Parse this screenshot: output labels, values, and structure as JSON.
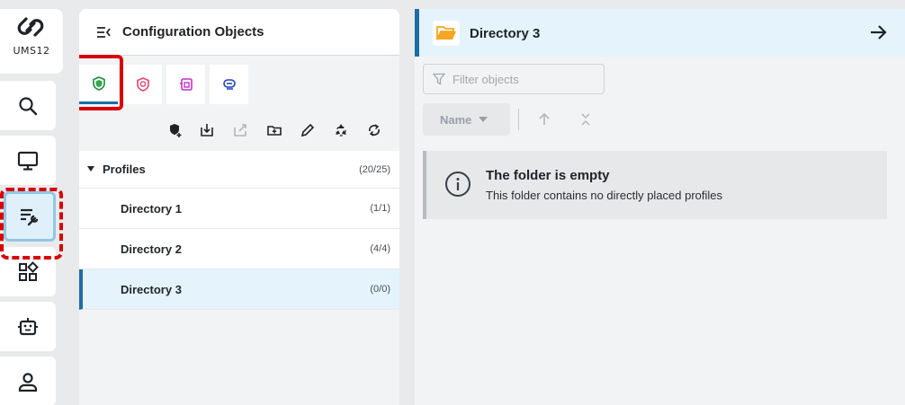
{
  "rail": {
    "logo_text": "UMS12",
    "items": [
      {
        "icon": "search-icon"
      },
      {
        "icon": "monitor-icon"
      },
      {
        "icon": "configuration-icon",
        "active": true
      },
      {
        "icon": "apps-icon"
      },
      {
        "icon": "robot-icon"
      },
      {
        "icon": "user-icon"
      }
    ]
  },
  "config_panel": {
    "title": "Configuration Objects",
    "tabs": [
      {
        "icon": "profile-shield-icon",
        "selected": true
      },
      {
        "icon": "priority-profile-icon"
      },
      {
        "icon": "template-profile-icon"
      },
      {
        "icon": "firmware-customization-icon"
      }
    ],
    "toolbar": [
      "new-profile-icon",
      "import-icon",
      "export-icon",
      "new-folder-icon",
      "edit-icon",
      "recycle-icon",
      "refresh-icon"
    ],
    "tree": {
      "root": {
        "label": "Profiles",
        "count": "(20/25)"
      },
      "children": [
        {
          "label": "Directory 1",
          "count": "(1/1)"
        },
        {
          "label": "Directory 2",
          "count": "(4/4)"
        },
        {
          "label": "Directory 3",
          "count": "(0/0)",
          "selected": true
        }
      ]
    }
  },
  "detail_panel": {
    "title": "Directory 3",
    "filter_placeholder": "Filter objects",
    "sort_label": "Name",
    "empty": {
      "title": "The folder is empty",
      "description": "This folder contains no directly placed profiles"
    }
  },
  "colors": {
    "accent": "#1b6ea3",
    "highlight_red": "#d80000",
    "selected_bg": "#e4f3fc",
    "folder": "#f5a623"
  }
}
